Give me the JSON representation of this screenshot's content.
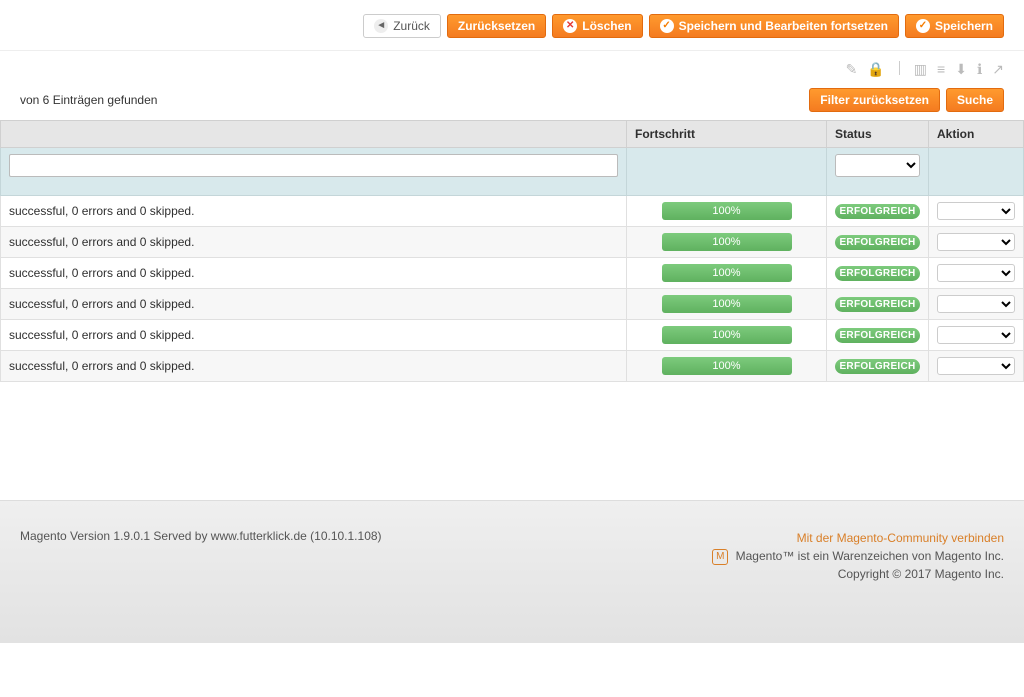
{
  "toolbar": {
    "back": "Zurück",
    "reset": "Zurücksetzen",
    "delete": "Löschen",
    "save_continue": "Speichern und Bearbeiten fortsetzen",
    "save": "Speichern"
  },
  "grid": {
    "count_label": "von 6 Einträgen gefunden",
    "filter_reset": "Filter zurücksetzen",
    "search": "Suche",
    "columns": {
      "message": "",
      "progress": "Fortschritt",
      "status": "Status",
      "action": "Aktion"
    },
    "rows": [
      {
        "msg": "successful, 0 errors and 0 skipped.",
        "progress": "100%",
        "status": "ERFOLGREICH"
      },
      {
        "msg": "successful, 0 errors and 0 skipped.",
        "progress": "100%",
        "status": "ERFOLGREICH"
      },
      {
        "msg": "successful, 0 errors and 0 skipped.",
        "progress": "100%",
        "status": "ERFOLGREICH"
      },
      {
        "msg": "successful, 0 errors and 0 skipped.",
        "progress": "100%",
        "status": "ERFOLGREICH"
      },
      {
        "msg": "successful, 0 errors and 0 skipped.",
        "progress": "100%",
        "status": "ERFOLGREICH"
      },
      {
        "msg": "successful, 0 errors and 0 skipped.",
        "progress": "100%",
        "status": "ERFOLGREICH"
      }
    ]
  },
  "footer": {
    "version": "Magento Version 1.9.0.1 Served by www.futterklick.de (10.10.1.108)",
    "community_link": "Mit der Magento-Community verbinden",
    "trademark": "Magento™ ist ein Warenzeichen von Magento Inc.",
    "copyright": "Copyright © 2017 Magento Inc."
  }
}
